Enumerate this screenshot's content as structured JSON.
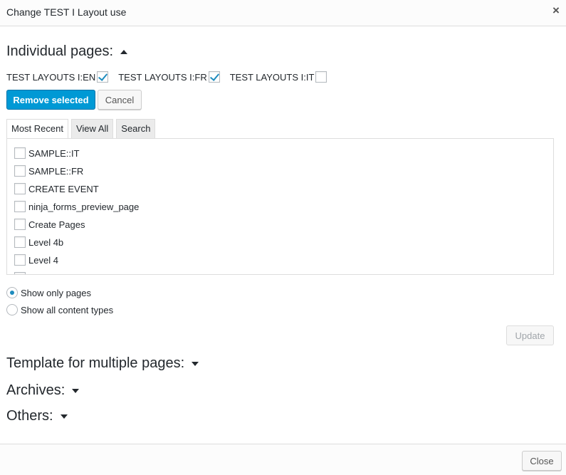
{
  "dialog": {
    "title": "Change TEST I Layout use",
    "close_icon": "×"
  },
  "individual_pages": {
    "heading": "Individual pages:",
    "expanded": true,
    "languages": [
      {
        "label": "TEST LAYOUTS I:EN",
        "checked": true
      },
      {
        "label": "TEST LAYOUTS I:FR",
        "checked": true
      },
      {
        "label": "TEST LAYOUTS I:IT",
        "checked": false
      }
    ],
    "remove_label": "Remove selected",
    "cancel_label": "Cancel",
    "tabs": [
      {
        "label": "Most Recent",
        "active": true
      },
      {
        "label": "View All",
        "active": false
      },
      {
        "label": "Search",
        "active": false
      }
    ],
    "pages": [
      "SAMPLE::IT",
      "SAMPLE::FR",
      "CREATE EVENT",
      "ninja_forms_preview_page",
      "Create Pages",
      "Level 4b",
      "Level 4"
    ],
    "filter": {
      "options": [
        {
          "label": "Show only pages",
          "selected": true
        },
        {
          "label": "Show all content types",
          "selected": false
        }
      ]
    },
    "update_label": "Update"
  },
  "sections": [
    {
      "heading": "Template for multiple pages:",
      "expanded": false
    },
    {
      "heading": "Archives:",
      "expanded": false
    },
    {
      "heading": "Others:",
      "expanded": false
    }
  ],
  "footer": {
    "close_label": "Close"
  },
  "colors": {
    "primary": "#0099d5",
    "check": "#1e8cbe",
    "border": "#dddddd"
  }
}
